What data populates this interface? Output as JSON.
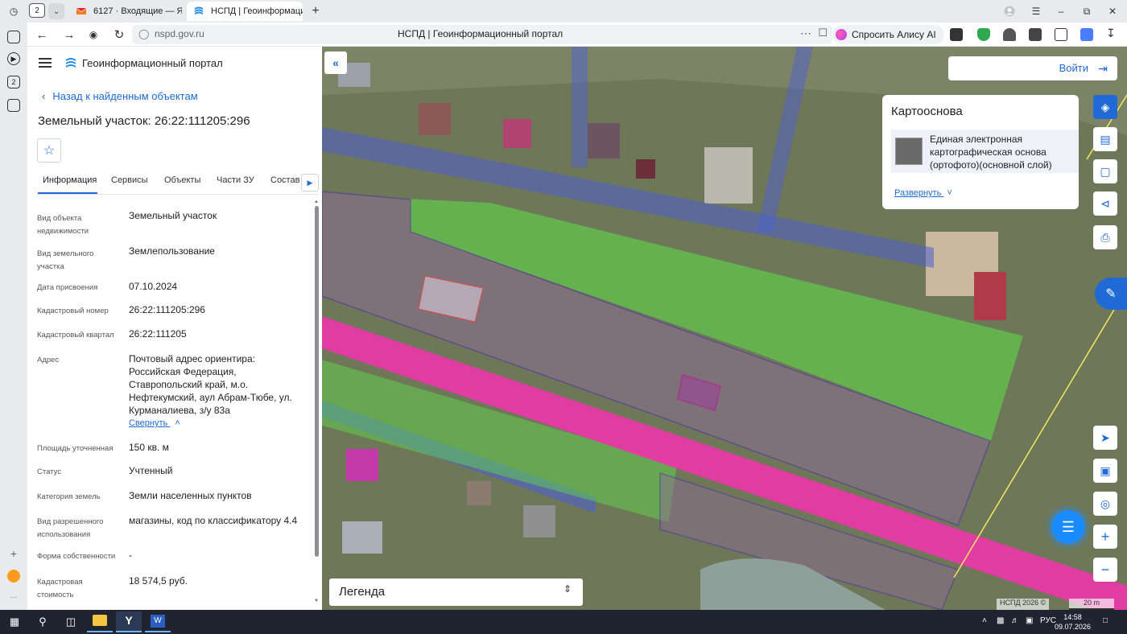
{
  "browser": {
    "tab_count": "2",
    "tabs": [
      {
        "title": "6127 · Входящие — Яндекс",
        "active": false
      },
      {
        "title": "НСПД | Геоинформационный портал",
        "active": true
      }
    ],
    "url": "nspd.gov.ru",
    "page_title": "НСПД | Геоинформационный портал",
    "alice_label": "Спросить Алису AI"
  },
  "panel": {
    "portal_name": "Геоинформационный портал",
    "back_link": "Назад к найденным объектам",
    "title": "Земельный участок: 26:22:111205:296",
    "tabs": [
      "Информация",
      "Сервисы",
      "Объекты",
      "Части ЗУ",
      "Состав"
    ],
    "active_tab": "Информация",
    "collapse_label": "Свернуть",
    "fields": [
      {
        "label": "Вид объекта недвижимости",
        "value": "Земельный участок"
      },
      {
        "label": "Вид земельного участка",
        "value": "Землепользование"
      },
      {
        "label": "Дата присвоения",
        "value": "07.10.2024"
      },
      {
        "label": "Кадастровый номер",
        "value": "26:22:111205:296"
      },
      {
        "label": "Кадастровый квартал",
        "value": "26:22:111205"
      },
      {
        "label": "Адрес",
        "value": "Почтовый адрес ориентира: Российская Федерация, Ставропольский край, м.о. Нефтекумский, аул Абрам-Тюбе, ул. Курманалиева, з/у 83а"
      },
      {
        "label": "Площадь уточненная",
        "value": "150 кв. м"
      },
      {
        "label": "Статус",
        "value": "Учтенный"
      },
      {
        "label": "Категория земель",
        "value": "Земли населенных пунктов"
      },
      {
        "label": "Вид разрешенного использования",
        "value": "магазины, код по классификатору 4.4"
      },
      {
        "label": "Форма собственности",
        "value": "-"
      },
      {
        "label": "Кадастровая стоимость",
        "value": "18 574,5 руб."
      }
    ]
  },
  "map": {
    "login_label": "Войти",
    "basemap": {
      "title": "Картооснова",
      "layer": "Единая электронная картографическая основа (ортофото)(основной слой)",
      "expand_label": "Развернуть"
    },
    "legend_label": "Легенда",
    "attribution": "НСПД 2026 ©",
    "scale_label": "20 m"
  },
  "taskbar": {
    "language": "РУС",
    "time": "14:58",
    "date": "09.07.2026"
  },
  "colors": {
    "accent": "#1f6ad4",
    "parcel_magenta": "#e63aa6",
    "zone_green": "#5fe04a",
    "road_blue": "#3a4fd6"
  }
}
